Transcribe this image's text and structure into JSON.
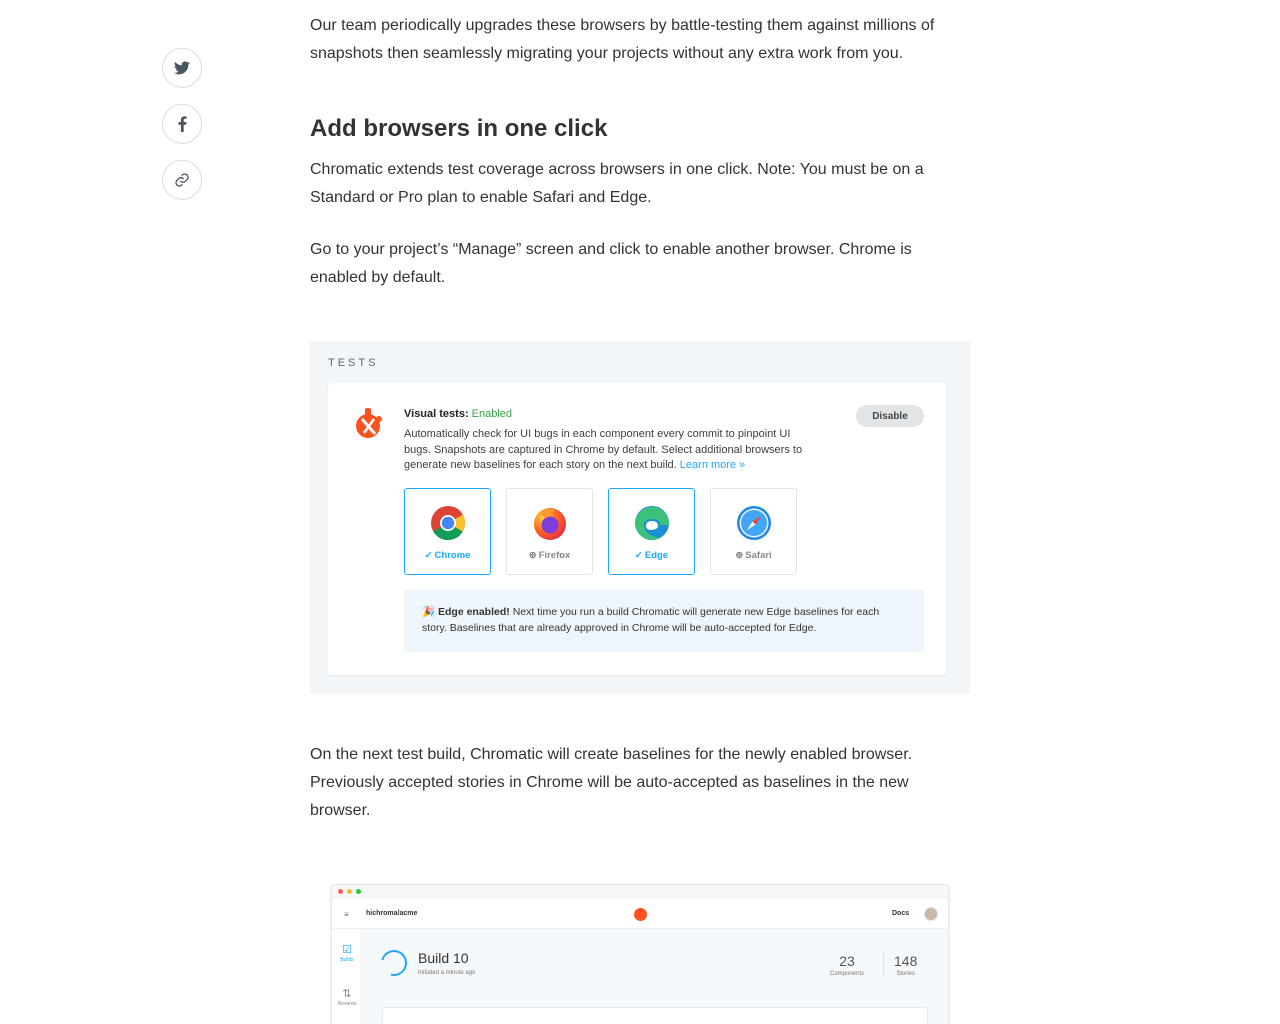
{
  "share": {
    "twitter_icon": "twitter-icon",
    "facebook_icon": "facebook-icon",
    "link_icon": "link-icon"
  },
  "article": {
    "intro": "Our team periodically upgrades these browsers by battle-testing them against millions of snapshots then seamlessly migrating your projects without any extra work from you.",
    "heading": "Add browsers in one click",
    "p1": "Chromatic extends test coverage across browsers in one click. Note: You must be on a Standard or Pro plan to enable Safari and Edge.",
    "p2": "Go to your project’s “Manage” screen and click to enable another browser. Chrome is enabled by default.",
    "p3": "On the next test build, Chromatic will create baselines for the newly enabled browser. Previously accepted stories in Chrome will be auto-accepted as baselines in the new browser."
  },
  "tests_panel": {
    "section_label": "TESTS",
    "title": "Visual tests:",
    "status": "Enabled",
    "description": "Automatically check for UI bugs in each component every commit to pinpoint UI bugs. Snapshots are captured in Chrome by default. Select additional browsers to generate new baselines for each story on the next build.",
    "learn_more": "Learn more »",
    "disable_label": "Disable",
    "browsers": [
      {
        "name": "Chrome",
        "icon": "chrome-icon",
        "selected": true,
        "marker": "✓"
      },
      {
        "name": "Firefox",
        "icon": "firefox-icon",
        "selected": false,
        "marker": "⊕"
      },
      {
        "name": "Edge",
        "icon": "edge-icon",
        "selected": true,
        "marker": "✓"
      },
      {
        "name": "Safari",
        "icon": "safari-icon",
        "selected": false,
        "marker": "⊕"
      }
    ],
    "notice_emoji": "🎉",
    "notice_bold": "Edge enabled!",
    "notice_text": "Next time you run a build Chromatic will generate new Edge baselines for each story. Baselines that are already approved in Chrome will be auto-accepted for Edge."
  },
  "app_screenshot": {
    "repo": "hichroma/acme",
    "docs": "Docs",
    "sidebar": [
      {
        "label": "Builds",
        "icon": "builds-icon",
        "active": true
      },
      {
        "label": "Reviews",
        "icon": "reviews-icon",
        "active": false
      }
    ],
    "build_title": "Build 10",
    "build_subtitle": "Initiated a minute ago",
    "components_count": "23",
    "components_label": "Components",
    "stories_count": "148",
    "stories_label": "Stories"
  },
  "colors": {
    "accent": "#1ea7fd",
    "enabled_green": "#37a244",
    "brand_orange": "#fc521f"
  }
}
